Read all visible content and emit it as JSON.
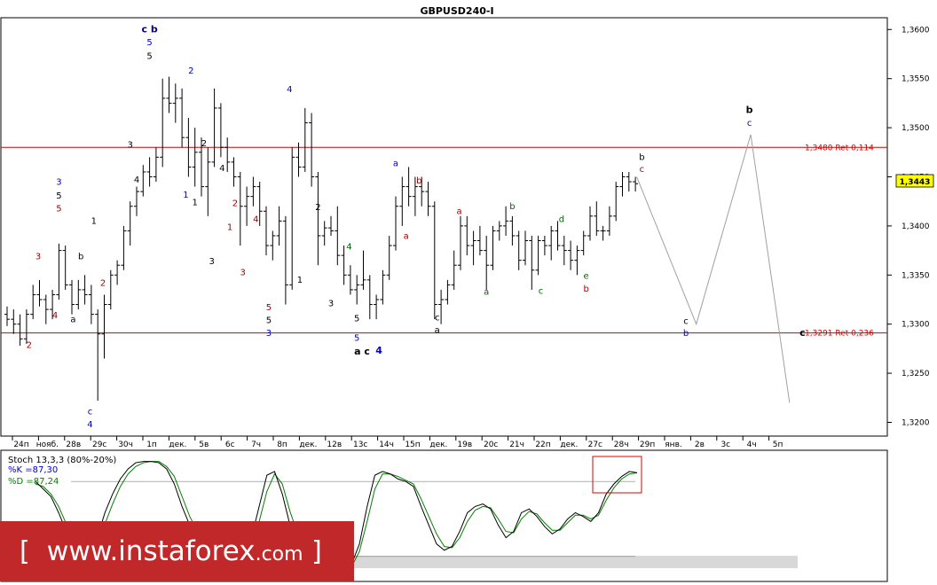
{
  "chart_data": {
    "type": "candlestick",
    "title": "GBPUSD240-I",
    "y_ticks": [
      "1,3600",
      "1,3550",
      "1,3500",
      "1,3450",
      "1,3400",
      "1,3350",
      "1,3300",
      "1,3250",
      "1,3200"
    ],
    "ylim": [
      1.3186,
      1.3612
    ],
    "last_price": "1,3443",
    "x_ticks": [
      "24п",
      "нояб.",
      "28в",
      "29с",
      "30ч",
      "1п",
      "дек.",
      "5в",
      "6с",
      "7ч",
      "8п",
      "дек.",
      "12в",
      "13с",
      "14ч",
      "15п",
      "дек.",
      "19в",
      "20с",
      "21ч",
      "22п",
      "дек.",
      "27с",
      "28ч",
      "29п",
      "янв.",
      "2в",
      "3с",
      "4ч",
      "5п"
    ],
    "levels": [
      {
        "label": "1,3480 Ret 0,114",
        "value": 1.348,
        "color": "#d00000"
      },
      {
        "label": "1,3291 Ret 0,236",
        "value": 1.3291,
        "color": "#d00000"
      }
    ],
    "projection": [
      {
        "x": 24.3,
        "y": 1.345
      },
      {
        "x": 26.6,
        "y": 1.33
      },
      {
        "x": 28.7,
        "y": 1.3493
      },
      {
        "x": 30.2,
        "y": 1.322
      }
    ],
    "bars": [
      [
        0.0,
        1.331,
        1.3318,
        1.3298,
        1.3305
      ],
      [
        0.25,
        1.3305,
        1.3315,
        1.329,
        1.33
      ],
      [
        0.5,
        1.33,
        1.331,
        1.3278,
        1.3285
      ],
      [
        0.75,
        1.3285,
        1.3315,
        1.328,
        1.331
      ],
      [
        1.0,
        1.331,
        1.334,
        1.3305,
        1.333
      ],
      [
        1.25,
        1.333,
        1.3345,
        1.3318,
        1.3325
      ],
      [
        1.5,
        1.3325,
        1.333,
        1.33,
        1.3315
      ],
      [
        1.75,
        1.3315,
        1.3335,
        1.3305,
        1.333
      ],
      [
        2.0,
        1.333,
        1.3382,
        1.3325,
        1.3375
      ],
      [
        2.25,
        1.3375,
        1.338,
        1.3335,
        1.334
      ],
      [
        2.5,
        1.334,
        1.3345,
        1.331,
        1.332
      ],
      [
        2.75,
        1.332,
        1.3345,
        1.3315,
        1.3335
      ],
      [
        3.0,
        1.3335,
        1.335,
        1.332,
        1.333
      ],
      [
        3.25,
        1.333,
        1.334,
        1.33,
        1.331
      ],
      [
        3.5,
        1.331,
        1.3315,
        1.3222,
        1.329
      ],
      [
        3.75,
        1.329,
        1.333,
        1.3265,
        1.332
      ],
      [
        4.0,
        1.332,
        1.3355,
        1.3315,
        1.335
      ],
      [
        4.25,
        1.335,
        1.3365,
        1.334,
        1.336
      ],
      [
        4.5,
        1.336,
        1.34,
        1.3355,
        1.3395
      ],
      [
        4.75,
        1.3395,
        1.3425,
        1.338,
        1.342
      ],
      [
        5.0,
        1.342,
        1.344,
        1.341,
        1.3435
      ],
      [
        5.25,
        1.3435,
        1.3462,
        1.343,
        1.3455
      ],
      [
        5.5,
        1.3455,
        1.347,
        1.344,
        1.345
      ],
      [
        5.75,
        1.345,
        1.348,
        1.3445,
        1.347
      ],
      [
        6.0,
        1.347,
        1.355,
        1.346,
        1.353
      ],
      [
        6.25,
        1.353,
        1.3552,
        1.3515,
        1.3525
      ],
      [
        6.5,
        1.3525,
        1.3545,
        1.3505,
        1.353
      ],
      [
        6.75,
        1.353,
        1.354,
        1.348,
        1.349
      ],
      [
        7.0,
        1.349,
        1.351,
        1.345,
        1.346
      ],
      [
        7.25,
        1.346,
        1.35,
        1.344,
        1.3475
      ],
      [
        7.5,
        1.3475,
        1.349,
        1.343,
        1.344
      ],
      [
        7.75,
        1.344,
        1.348,
        1.341,
        1.3465
      ],
      [
        8.0,
        1.3465,
        1.354,
        1.346,
        1.352
      ],
      [
        8.25,
        1.352,
        1.3525,
        1.347,
        1.348
      ],
      [
        8.5,
        1.348,
        1.349,
        1.3455,
        1.3465
      ],
      [
        8.75,
        1.3465,
        1.347,
        1.344,
        1.345
      ],
      [
        9.0,
        1.345,
        1.3455,
        1.338,
        1.342
      ],
      [
        9.25,
        1.342,
        1.344,
        1.34,
        1.343
      ],
      [
        9.5,
        1.343,
        1.345,
        1.342,
        1.344
      ],
      [
        9.75,
        1.344,
        1.3445,
        1.34,
        1.3415
      ],
      [
        10.0,
        1.3415,
        1.342,
        1.337,
        1.338
      ],
      [
        10.25,
        1.338,
        1.3395,
        1.3365,
        1.339
      ],
      [
        10.5,
        1.339,
        1.342,
        1.338,
        1.3405
      ],
      [
        10.75,
        1.3405,
        1.341,
        1.332,
        1.334
      ],
      [
        11.0,
        1.334,
        1.348,
        1.3335,
        1.347
      ],
      [
        11.25,
        1.347,
        1.3485,
        1.345,
        1.346
      ],
      [
        11.5,
        1.346,
        1.352,
        1.3455,
        1.3505
      ],
      [
        11.75,
        1.3505,
        1.3515,
        1.344,
        1.345
      ],
      [
        12.0,
        1.345,
        1.3455,
        1.336,
        1.339
      ],
      [
        12.25,
        1.339,
        1.3405,
        1.338,
        1.3398
      ],
      [
        12.5,
        1.3398,
        1.341,
        1.339,
        1.3395
      ],
      [
        12.75,
        1.3395,
        1.342,
        1.336,
        1.337
      ],
      [
        13.0,
        1.337,
        1.338,
        1.334,
        1.335
      ],
      [
        13.25,
        1.335,
        1.336,
        1.333,
        1.3335
      ],
      [
        13.5,
        1.3335,
        1.335,
        1.332,
        1.334
      ],
      [
        13.75,
        1.334,
        1.3375,
        1.3335,
        1.3345
      ],
      [
        14.0,
        1.3345,
        1.335,
        1.3305,
        1.332
      ],
      [
        14.25,
        1.332,
        1.333,
        1.3305,
        1.3325
      ],
      [
        14.5,
        1.3325,
        1.3355,
        1.332,
        1.335
      ],
      [
        14.75,
        1.335,
        1.339,
        1.3345,
        1.338
      ],
      [
        15.0,
        1.338,
        1.343,
        1.3375,
        1.342
      ],
      [
        15.25,
        1.342,
        1.345,
        1.34,
        1.344
      ],
      [
        15.5,
        1.344,
        1.346,
        1.342,
        1.343
      ],
      [
        15.75,
        1.343,
        1.345,
        1.341,
        1.344
      ],
      [
        16.0,
        1.344,
        1.345,
        1.342,
        1.3435
      ],
      [
        16.25,
        1.3435,
        1.3445,
        1.341,
        1.342
      ],
      [
        16.5,
        1.342,
        1.3425,
        1.3305,
        1.332
      ],
      [
        16.75,
        1.332,
        1.3335,
        1.33,
        1.3325
      ],
      [
        17.0,
        1.3325,
        1.3345,
        1.332,
        1.334
      ],
      [
        17.25,
        1.334,
        1.3375,
        1.3335,
        1.336
      ],
      [
        17.5,
        1.336,
        1.341,
        1.3355,
        1.34
      ],
      [
        17.75,
        1.34,
        1.341,
        1.337,
        1.338
      ],
      [
        18.0,
        1.338,
        1.3395,
        1.336,
        1.3385
      ],
      [
        18.25,
        1.3385,
        1.34,
        1.337,
        1.3375
      ],
      [
        18.5,
        1.3375,
        1.339,
        1.3335,
        1.336
      ],
      [
        18.75,
        1.336,
        1.34,
        1.3355,
        1.3395
      ],
      [
        19.0,
        1.3395,
        1.3405,
        1.3385,
        1.34
      ],
      [
        19.25,
        1.34,
        1.342,
        1.339,
        1.3405
      ],
      [
        19.5,
        1.3405,
        1.341,
        1.338,
        1.339
      ],
      [
        19.75,
        1.339,
        1.3395,
        1.3355,
        1.3365
      ],
      [
        20.0,
        1.3365,
        1.3395,
        1.336,
        1.3385
      ],
      [
        20.25,
        1.3385,
        1.339,
        1.3335,
        1.3355
      ],
      [
        20.5,
        1.3355,
        1.339,
        1.335,
        1.3385
      ],
      [
        20.75,
        1.3385,
        1.339,
        1.337,
        1.338
      ],
      [
        21.0,
        1.338,
        1.34,
        1.3365,
        1.3395
      ],
      [
        21.25,
        1.3395,
        1.3405,
        1.3375,
        1.338
      ],
      [
        21.5,
        1.338,
        1.339,
        1.336,
        1.3375
      ],
      [
        21.75,
        1.3375,
        1.3385,
        1.3355,
        1.3365
      ],
      [
        22.0,
        1.3365,
        1.338,
        1.335,
        1.3375
      ],
      [
        22.25,
        1.3375,
        1.3395,
        1.337,
        1.339
      ],
      [
        22.5,
        1.339,
        1.342,
        1.3385,
        1.341
      ],
      [
        22.75,
        1.341,
        1.3425,
        1.339,
        1.3395
      ],
      [
        23.0,
        1.3395,
        1.34,
        1.3385,
        1.3395
      ],
      [
        23.25,
        1.3395,
        1.342,
        1.339,
        1.341
      ],
      [
        23.5,
        1.341,
        1.3445,
        1.3405,
        1.344
      ],
      [
        23.75,
        1.344,
        1.3455,
        1.343,
        1.345
      ],
      [
        24.0,
        1.345,
        1.3455,
        1.3435,
        1.3445
      ],
      [
        24.25,
        1.3445,
        1.345,
        1.3435,
        1.3443
      ]
    ],
    "wave_labels": [
      {
        "text": "c b",
        "x": 5.5,
        "y": 1.3597,
        "color": "#000099",
        "bold": true
      },
      {
        "text": "5",
        "x": 5.5,
        "y": 1.3584,
        "color": "#0000cc"
      },
      {
        "text": "5",
        "x": 5.5,
        "y": 1.357,
        "color": "#000000"
      },
      {
        "text": "2",
        "x": 7.1,
        "y": 1.3555,
        "color": "#0000cc"
      },
      {
        "text": "4",
        "x": 10.9,
        "y": 1.3536,
        "color": "#0000cc"
      },
      {
        "text": "3",
        "x": 4.75,
        "y": 1.348,
        "color": "#000000"
      },
      {
        "text": "2",
        "x": 7.6,
        "y": 1.3481,
        "color": "#000000"
      },
      {
        "text": "4",
        "x": 8.3,
        "y": 1.3456,
        "color": "#000000"
      },
      {
        "text": "2",
        "x": 8.8,
        "y": 1.342,
        "color": "#990000"
      },
      {
        "text": "2",
        "x": 12.0,
        "y": 1.3416,
        "color": "#000000"
      },
      {
        "text": "4",
        "x": 9.6,
        "y": 1.3404,
        "color": "#990000"
      },
      {
        "text": "1",
        "x": 8.6,
        "y": 1.3396,
        "color": "#990000"
      },
      {
        "text": "4",
        "x": 13.2,
        "y": 1.3376,
        "color": "#006600"
      },
      {
        "text": "3",
        "x": 2.0,
        "y": 1.3442,
        "color": "#0000cc"
      },
      {
        "text": "5",
        "x": 2.0,
        "y": 1.3428,
        "color": "#000000"
      },
      {
        "text": "5",
        "x": 2.0,
        "y": 1.3415,
        "color": "#990000"
      },
      {
        "text": "1",
        "x": 3.35,
        "y": 1.3402,
        "color": "#000000"
      },
      {
        "text": "4",
        "x": 5.0,
        "y": 1.3444,
        "color": "#000000"
      },
      {
        "text": "1",
        "x": 6.9,
        "y": 1.3429,
        "color": "#0000cc"
      },
      {
        "text": "1",
        "x": 7.25,
        "y": 1.3421,
        "color": "#000000"
      },
      {
        "text": "3",
        "x": 1.2,
        "y": 1.3366,
        "color": "#990000"
      },
      {
        "text": "b",
        "x": 2.85,
        "y": 1.3366,
        "color": "#000000"
      },
      {
        "text": "2",
        "x": 3.7,
        "y": 1.3339,
        "color": "#990000"
      },
      {
        "text": "3",
        "x": 7.9,
        "y": 1.3361,
        "color": "#000000"
      },
      {
        "text": "3",
        "x": 9.1,
        "y": 1.335,
        "color": "#990000"
      },
      {
        "text": "1",
        "x": 11.3,
        "y": 1.3342,
        "color": "#000000"
      },
      {
        "text": "3",
        "x": 12.5,
        "y": 1.3318,
        "color": "#000000"
      },
      {
        "text": "4",
        "x": 1.85,
        "y": 1.3306,
        "color": "#990000"
      },
      {
        "text": "a",
        "x": 2.55,
        "y": 1.3302,
        "color": "#000000"
      },
      {
        "text": "2",
        "x": 0.85,
        "y": 1.3276,
        "color": "#990000"
      },
      {
        "text": "5",
        "x": 10.1,
        "y": 1.3314,
        "color": "#990000"
      },
      {
        "text": "5",
        "x": 10.1,
        "y": 1.3301,
        "color": "#000000"
      },
      {
        "text": "3",
        "x": 10.1,
        "y": 1.3288,
        "color": "#0000cc"
      },
      {
        "text": "5",
        "x": 13.5,
        "y": 1.3303,
        "color": "#000000"
      },
      {
        "text": "5",
        "x": 13.5,
        "y": 1.3283,
        "color": "#0000cc"
      },
      {
        "text": "a c",
        "x": 13.7,
        "y": 1.3269,
        "color": "#000000",
        "bold": true
      },
      {
        "text": "4",
        "x": 14.35,
        "y": 1.327,
        "color": "#0000cc",
        "bold": true
      },
      {
        "text": "c",
        "x": 3.2,
        "y": 1.3208,
        "color": "#000099"
      },
      {
        "text": "4",
        "x": 3.2,
        "y": 1.3195,
        "color": "#0000cc"
      },
      {
        "text": "a",
        "x": 15.0,
        "y": 1.3461,
        "color": "#0000cc"
      },
      {
        "text": "b",
        "x": 15.9,
        "y": 1.3443,
        "color": "#990000"
      },
      {
        "text": "a",
        "x": 17.45,
        "y": 1.3412,
        "color": "#990000"
      },
      {
        "text": "a",
        "x": 15.4,
        "y": 1.3387,
        "color": "#990000"
      },
      {
        "text": "b",
        "x": 19.5,
        "y": 1.3417,
        "color": "#006600"
      },
      {
        "text": "d",
        "x": 21.4,
        "y": 1.3404,
        "color": "#006600"
      },
      {
        "text": "a",
        "x": 18.5,
        "y": 1.333,
        "color": "#006600"
      },
      {
        "text": "c",
        "x": 20.6,
        "y": 1.3331,
        "color": "#006600"
      },
      {
        "text": "e",
        "x": 22.35,
        "y": 1.3346,
        "color": "#006600"
      },
      {
        "text": "b",
        "x": 22.35,
        "y": 1.3333,
        "color": "#990000"
      },
      {
        "text": "c",
        "x": 16.6,
        "y": 1.3304,
        "color": "#000000"
      },
      {
        "text": "a",
        "x": 16.6,
        "y": 1.3291,
        "color": "#000000"
      },
      {
        "text": "b",
        "x": 24.5,
        "y": 1.3467,
        "color": "#000000"
      },
      {
        "text": "c",
        "x": 24.5,
        "y": 1.3455,
        "color": "#990000"
      },
      {
        "text": "b",
        "x": 28.65,
        "y": 1.3515,
        "color": "#000000",
        "bold": true
      },
      {
        "text": "c",
        "x": 28.65,
        "y": 1.3502,
        "color": "#0000cc"
      },
      {
        "text": "c",
        "x": 26.2,
        "y": 1.33,
        "color": "#000000"
      },
      {
        "text": "b",
        "x": 26.2,
        "y": 1.3288,
        "color": "#0000cc"
      },
      {
        "text": "c",
        "x": 30.7,
        "y": 1.3288,
        "color": "#000000",
        "bold": true
      }
    ]
  },
  "oscillator": {
    "name": "Stoch 13,3,3 (80%-20%)",
    "k_label": "%K =87,30",
    "d_label": "%D =87,24",
    "k_color": "#0000cc",
    "d_color": "#008000",
    "levels": [
      80,
      20
    ],
    "k": [
      80,
      74,
      68,
      55,
      40,
      25,
      15,
      20,
      35,
      55,
      70,
      82,
      90,
      95,
      96,
      96,
      95,
      90,
      78,
      60,
      45,
      35,
      30,
      28,
      25,
      24,
      22,
      26,
      35,
      60,
      85,
      88,
      70,
      45,
      30,
      28,
      20,
      15,
      12,
      10,
      8,
      14,
      30,
      60,
      85,
      88,
      86,
      82,
      80,
      76,
      60,
      45,
      30,
      25,
      28,
      40,
      55,
      60,
      62,
      58,
      45,
      35,
      40,
      55,
      58,
      52,
      44,
      38,
      42,
      50,
      55,
      52,
      48,
      55,
      70,
      78,
      84,
      88,
      87
    ],
    "d": [
      78,
      76,
      70,
      60,
      46,
      32,
      20,
      18,
      28,
      46,
      62,
      76,
      86,
      92,
      95,
      96,
      96,
      92,
      84,
      68,
      52,
      40,
      33,
      30,
      27,
      25,
      23,
      25,
      30,
      48,
      72,
      86,
      78,
      56,
      38,
      30,
      24,
      18,
      14,
      12,
      10,
      12,
      24,
      48,
      74,
      86,
      86,
      84,
      81,
      78,
      66,
      52,
      38,
      28,
      27,
      35,
      48,
      57,
      60,
      59,
      50,
      40,
      39,
      50,
      56,
      54,
      47,
      41,
      41,
      47,
      53,
      53,
      50,
      53,
      65,
      75,
      82,
      86,
      87
    ]
  },
  "banner": {
    "open_bracket": "[",
    "www": "www.",
    "domain": "instaforex",
    "suffix": ".com",
    "close_bracket": "]"
  }
}
